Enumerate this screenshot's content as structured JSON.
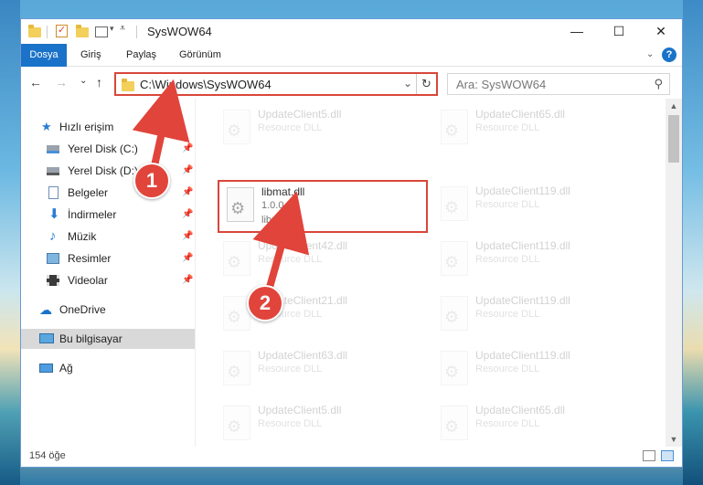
{
  "window": {
    "title": "SysWOW64",
    "controls": {
      "minimize": "—",
      "maximize": "☐",
      "close": "✕"
    }
  },
  "ribbon": {
    "tabs": [
      "Dosya",
      "Giriş",
      "Paylaş",
      "Görünüm"
    ],
    "expand": "⌄",
    "help": "?"
  },
  "address": {
    "path": "C:\\Windows\\SysWOW64",
    "dropdown": "⌄",
    "refresh": "↻"
  },
  "search": {
    "placeholder": "Ara: SysWOW64",
    "icon": "search-icon"
  },
  "nav": {
    "back": "←",
    "forward": "→",
    "recent": "⌄",
    "up": "↑",
    "items": [
      {
        "label": "Hızlı erişim",
        "icon": "star-icon",
        "pinned": false
      },
      {
        "label": "Yerel Disk (C:)",
        "icon": "drive-icon",
        "pinned": true
      },
      {
        "label": "Yerel Disk (D:)",
        "icon": "drive-icon",
        "pinned": true
      },
      {
        "label": "Belgeler",
        "icon": "documents-icon",
        "pinned": true
      },
      {
        "label": "İndirmeler",
        "icon": "download-icon",
        "pinned": true
      },
      {
        "label": "Müzik",
        "icon": "music-icon",
        "pinned": true
      },
      {
        "label": "Resimler",
        "icon": "pictures-icon",
        "pinned": true
      },
      {
        "label": "Videolar",
        "icon": "videos-icon",
        "pinned": true
      },
      {
        "label": "OneDrive",
        "icon": "cloud-icon",
        "pinned": false
      },
      {
        "label": "Bu bilgisayar",
        "icon": "computer-icon",
        "pinned": false
      },
      {
        "label": "Ağ",
        "icon": "network-icon",
        "pinned": false
      }
    ]
  },
  "files": {
    "left": [
      {
        "name": "UpdateClient5.dll",
        "desc": "Resource DLL"
      },
      {
        "name": "libmat.dll",
        "desc": "1.0.0.1",
        "desc2": "libmat"
      },
      {
        "name": "UpdateClient42.dll",
        "desc": "Resource DLL"
      },
      {
        "name": "UpdateClient21.dll",
        "desc": "Resource DLL"
      },
      {
        "name": "UpdateClient63.dll",
        "desc": "Resource DLL"
      },
      {
        "name": "UpdateClient5.dll",
        "desc": "Resource DLL"
      }
    ],
    "right": [
      {
        "name": "UpdateClient65.dll",
        "desc": "Resource DLL"
      },
      {
        "name": "UpdateClient119.dll",
        "desc": "Resource DLL"
      },
      {
        "name": "UpdateClient119.dll",
        "desc": "Resource DLL"
      },
      {
        "name": "UpdateClient119.dll",
        "desc": "Resource DLL"
      },
      {
        "name": "UpdateClient119.dll",
        "desc": "Resource DLL"
      },
      {
        "name": "UpdateClient65.dll",
        "desc": "Resource DLL"
      }
    ]
  },
  "status": {
    "count": "154 öğe"
  },
  "annotations": {
    "step1": "1",
    "step2": "2",
    "color": "#e1443a"
  }
}
